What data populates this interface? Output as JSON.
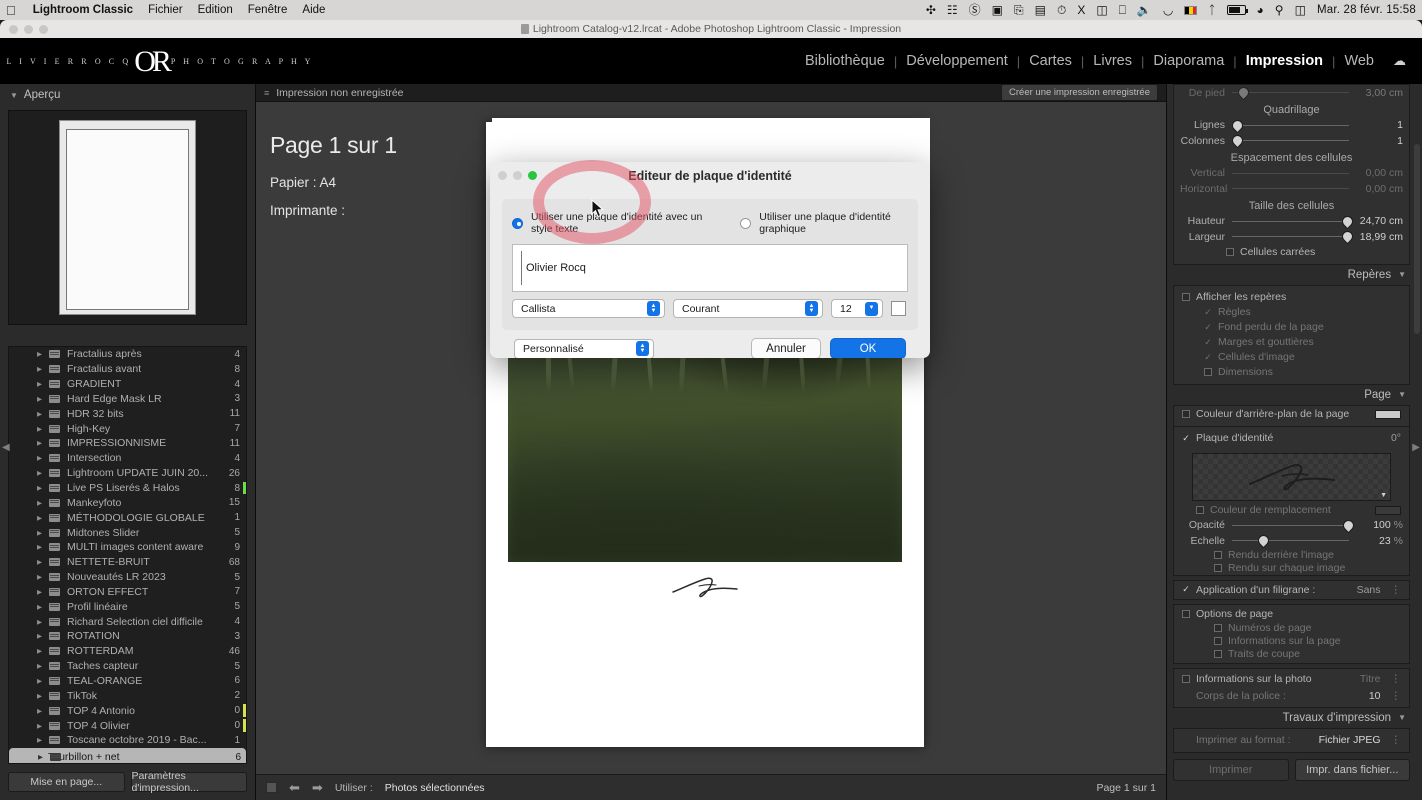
{
  "menubar": {
    "apple": "apple-logo",
    "app": "Lightroom Classic",
    "items": [
      "Fichier",
      "Edition",
      "Fenêtre",
      "Aide"
    ],
    "status_icons": [
      "butterfly-icon",
      "adjust-badge-icon",
      "no-entry-icon",
      "screen-record-icon",
      "airplay-icon",
      "battery-list-icon",
      "clock-icon",
      "binoculars-icon",
      "columns-icon",
      "display-icon",
      "volume-icon",
      "arc-icon",
      "belgium-flag-icon",
      "bluetooth-icon",
      "battery-charging-icon",
      "wifi-icon",
      "search-icon",
      "control-center-icon"
    ],
    "clock": "Mar. 28 févr.  15:58"
  },
  "window": {
    "title": "Lightroom Catalog-v12.lrcat - Adobe Photoshop Lightroom Classic - Impression"
  },
  "header": {
    "identity_plate": {
      "left_text": "O L I V I E R   R O C Q",
      "monogram": "OR",
      "right_text": "P H O T O G R A P H Y"
    },
    "modules": [
      {
        "label": "Bibliothèque",
        "active": false
      },
      {
        "label": "Développement",
        "active": false
      },
      {
        "label": "Cartes",
        "active": false
      },
      {
        "label": "Livres",
        "active": false
      },
      {
        "label": "Diaporama",
        "active": false
      },
      {
        "label": "Impression",
        "active": true
      },
      {
        "label": "Web",
        "active": false
      }
    ],
    "cloud_icon": "cloud-icon"
  },
  "left_panel": {
    "preview_title": "Aperçu",
    "folders": [
      {
        "name": "Fractalius après",
        "count": "4",
        "selected": false,
        "mark": ""
      },
      {
        "name": "Fractalius avant",
        "count": "8",
        "selected": false,
        "mark": ""
      },
      {
        "name": "GRADIENT",
        "count": "4",
        "selected": false,
        "mark": ""
      },
      {
        "name": "Hard Edge Mask LR",
        "count": "3",
        "selected": false,
        "mark": ""
      },
      {
        "name": "HDR 32 bits",
        "count": "11",
        "selected": false,
        "mark": ""
      },
      {
        "name": "High-Key",
        "count": "7",
        "selected": false,
        "mark": ""
      },
      {
        "name": "IMPRESSIONNISME",
        "count": "11",
        "selected": false,
        "mark": ""
      },
      {
        "name": "Intersection",
        "count": "4",
        "selected": false,
        "mark": ""
      },
      {
        "name": "Lightroom UPDATE JUIN 20...",
        "count": "26",
        "selected": false,
        "mark": ""
      },
      {
        "name": "Live PS Liserés & Halos",
        "count": "8",
        "selected": false,
        "mark": "#6ddc4a"
      },
      {
        "name": "Mankeyfoto",
        "count": "15",
        "selected": false,
        "mark": ""
      },
      {
        "name": "MÉTHODOLOGIE GLOBALE",
        "count": "1",
        "selected": false,
        "mark": ""
      },
      {
        "name": "Midtones Slider",
        "count": "5",
        "selected": false,
        "mark": ""
      },
      {
        "name": "MULTI images content aware",
        "count": "9",
        "selected": false,
        "mark": ""
      },
      {
        "name": "NETTETE-BRUIT",
        "count": "68",
        "selected": false,
        "mark": ""
      },
      {
        "name": "Nouveautés LR 2023",
        "count": "5",
        "selected": false,
        "mark": ""
      },
      {
        "name": "ORTON EFFECT",
        "count": "7",
        "selected": false,
        "mark": ""
      },
      {
        "name": "Profil linéaire",
        "count": "5",
        "selected": false,
        "mark": ""
      },
      {
        "name": "Richard Selection ciel difficile",
        "count": "4",
        "selected": false,
        "mark": ""
      },
      {
        "name": "ROTATION",
        "count": "3",
        "selected": false,
        "mark": ""
      },
      {
        "name": "ROTTERDAM",
        "count": "46",
        "selected": false,
        "mark": ""
      },
      {
        "name": "Taches capteur",
        "count": "5",
        "selected": false,
        "mark": ""
      },
      {
        "name": "TEAL-ORANGE",
        "count": "6",
        "selected": false,
        "mark": ""
      },
      {
        "name": "TikTok",
        "count": "2",
        "selected": false,
        "mark": ""
      },
      {
        "name": "TOP 4 Antonio",
        "count": "0",
        "selected": false,
        "mark": "#d8e04a"
      },
      {
        "name": "TOP 4 Olivier",
        "count": "0",
        "selected": false,
        "mark": "#d8e04a"
      },
      {
        "name": "Toscane octobre 2019 - Bac...",
        "count": "1",
        "selected": false,
        "mark": ""
      },
      {
        "name": "Tourbillon + net",
        "count": "6",
        "selected": true,
        "mark": ""
      }
    ],
    "buttons": [
      {
        "label": "Mise en page..."
      },
      {
        "label": "Paramètres d'impression..."
      }
    ]
  },
  "center": {
    "filmstrip_label": "Impression non enregistrée",
    "save_button": "Créer une impression enregistrée",
    "page_title": "Page 1 sur 1",
    "paper": "Papier : A4",
    "printer": "Imprimante :",
    "toolbar": {
      "use_label": "Utiliser :",
      "use_value": "Photos sélectionnées",
      "page_indicator": "Page 1 sur 1"
    }
  },
  "right_panel": {
    "layout": {
      "foot_label": "De pied",
      "foot_value": "3,00 cm",
      "grid_header": "Quadrillage",
      "rows_label": "Lignes",
      "rows_value": "1",
      "cols_label": "Colonnes",
      "cols_value": "1",
      "spacing_header": "Espacement des cellules",
      "vertical_label": "Vertical",
      "vertical_value": "0,00 cm",
      "horizontal_label": "Horizontal",
      "horizontal_value": "0,00 cm",
      "size_header": "Taille des cellules",
      "height_label": "Hauteur",
      "height_value": "24,70 cm",
      "width_label": "Largeur",
      "width_value": "18,99 cm",
      "square_cells": "Cellules carrées"
    },
    "guides": {
      "title": "Repères",
      "show_guides": "Afficher les repères",
      "items": [
        {
          "label": "Règles",
          "checked": true
        },
        {
          "label": "Fond perdu de la page",
          "checked": true
        },
        {
          "label": "Marges et gouttières",
          "checked": true
        },
        {
          "label": "Cellules d'image",
          "checked": true
        },
        {
          "label": "Dimensions",
          "checked": false
        }
      ]
    },
    "page": {
      "title": "Page",
      "bg_color_label": "Couleur d'arrière-plan de la page",
      "identity_plate_label": "Plaque d'identité",
      "identity_plate_angle": "0°",
      "override_color_label": "Couleur de remplacement",
      "opacity_label": "Opacité",
      "opacity_value": "100",
      "opacity_unit": "%",
      "scale_label": "Echelle",
      "scale_value": "23",
      "scale_unit": "%",
      "render_behind": "Rendu derrière l'image",
      "render_each": "Rendu sur chaque image",
      "watermark_label": "Application d'un filigrane :",
      "watermark_value": "Sans",
      "page_options_label": "Options de page",
      "page_options": [
        {
          "label": "Numéros de page"
        },
        {
          "label": "Informations sur la page"
        },
        {
          "label": "Traits de coupe"
        }
      ],
      "photo_info_label": "Informations sur la photo",
      "photo_info_value": "Titre",
      "font_size_label": "Corps de la police :",
      "font_size_value": "10"
    },
    "print_job": {
      "title": "Travaux d'impression",
      "print_to_label": "Imprimer au format :",
      "print_to_value": "Fichier JPEG",
      "print_button": "Imprimer",
      "print_file_button": "Impr. dans fichier..."
    }
  },
  "dialog": {
    "title": "Editeur de plaque d'identité",
    "radio_text": "Utiliser une plaque d'identité avec un style texte",
    "radio_graphic": "Utiliser une plaque d'identité graphique",
    "text_value": "Olivier Rocq",
    "font_family": "Callista",
    "font_style": "Courant",
    "font_size": "12",
    "preset": "Personnalisé",
    "cancel": "Annuler",
    "ok": "OK",
    "accent_color": "#1473e6",
    "highlight_color": "#e25668"
  }
}
